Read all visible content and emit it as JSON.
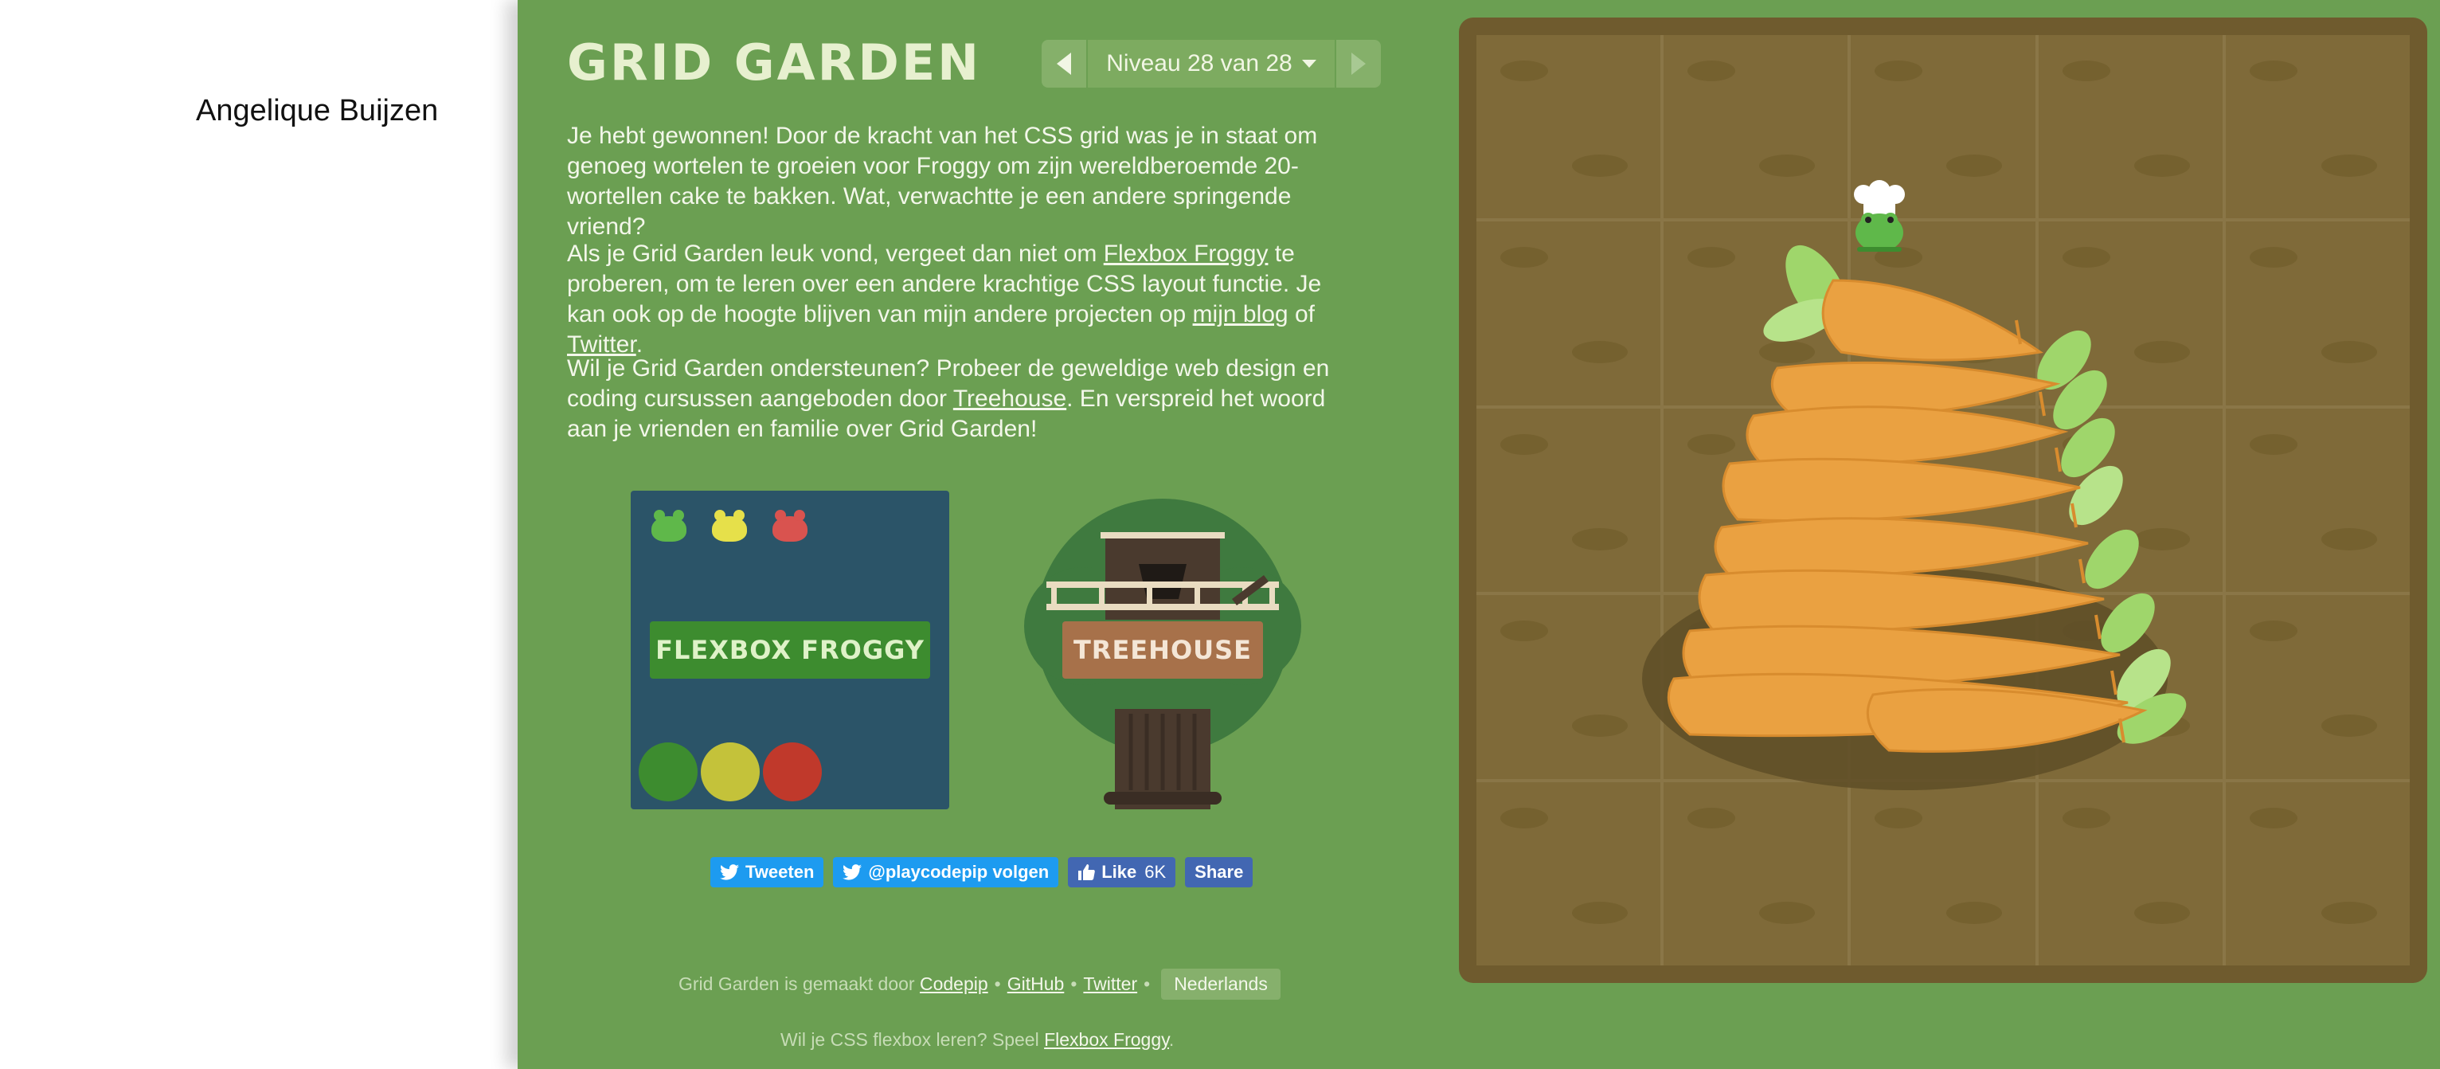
{
  "author": "Angelique Buijzen",
  "header": {
    "title": "GRID GARDEN",
    "level_label": "Niveau 28 van 28"
  },
  "paragraph1": {
    "text": "Je hebt gewonnen! Door de kracht van het CSS grid was je in staat om genoeg wortelen te groeien voor Froggy om zijn wereldberoemde 20-wortellen cake te bakken. Wat, verwachtte je een andere springende vriend?"
  },
  "paragraph2": {
    "part1": "Als je Grid Garden leuk vond, vergeet dan niet om ",
    "link1": "Flexbox Froggy",
    "part2": " te proberen, om te leren over een andere krachtige CSS layout functie. Je kan ook op de hoogte blijven van mijn andere projecten op ",
    "link2": "mijn blog",
    "part3": " of ",
    "link3": "Twitter",
    "part4": "."
  },
  "paragraph3": {
    "part1": "Wil je Grid Garden ondersteunen? Probeer de geweldige web design en coding cursussen aangeboden door ",
    "link1": "Treehouse",
    "part2": ". En verspreid het woord aan je vrienden en familie over Grid Garden!"
  },
  "cards": {
    "froggy_label": "FLEXBOX FROGGY",
    "treehouse_label": "TREEHOUSE"
  },
  "social": {
    "tweet": "Tweeten",
    "follow": "@playcodepip volgen",
    "like": "Like",
    "like_count": "6K",
    "share": "Share"
  },
  "footer": {
    "made_by": "Grid Garden is gemaakt door",
    "codepip": "Codepip",
    "github": "GitHub",
    "twitter": "Twitter",
    "separator": "•",
    "language": "Nederlands",
    "flexbox_prompt": "Wil je CSS flexbox leren? Speel",
    "flexbox_link": "Flexbox Froggy",
    "period": "."
  },
  "colors": {
    "page_green": "#6b9f52",
    "soil": "#7f6a39",
    "carrot": "#eaa141",
    "leaf": "#9fd66b",
    "frog": "#5fb84a"
  },
  "icons": [
    "arrow-left-icon",
    "arrow-right-icon",
    "caret-down-icon",
    "twitter-bird-icon",
    "thumbs-up-icon",
    "frog-chef-icon",
    "carrot-icon"
  ]
}
